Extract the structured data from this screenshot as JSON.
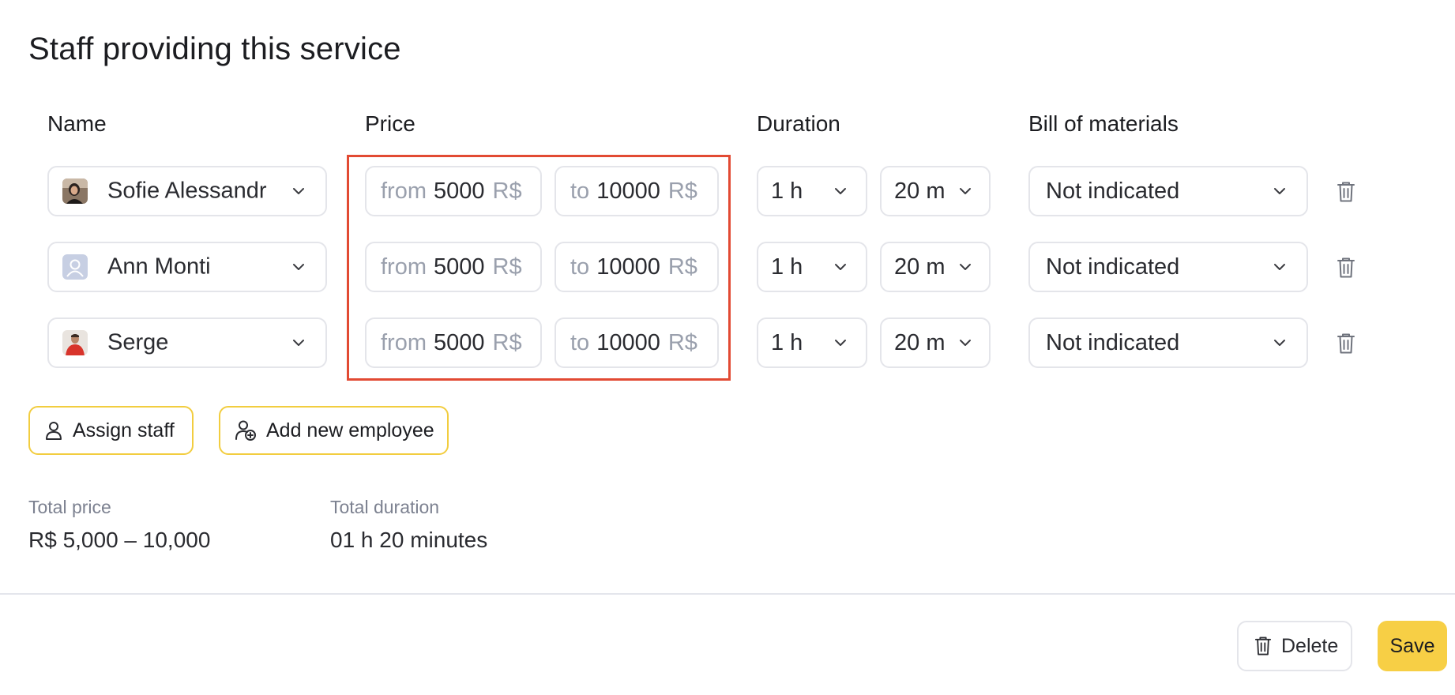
{
  "title": "Staff providing this service",
  "columns": {
    "name": "Name",
    "price": "Price",
    "duration": "Duration",
    "bom": "Bill of materials"
  },
  "rows": [
    {
      "name": "Sofie Alessandr",
      "avatar": "photo-avatar-woman",
      "from_label": "from",
      "from_value": "5000",
      "to_label": "to",
      "to_value": "10000",
      "currency": "R$",
      "hours": "1 h",
      "minutes": "20 m",
      "bom": "Not indicated"
    },
    {
      "name": "Ann Monti",
      "avatar": "placeholder-avatar",
      "from_label": "from",
      "from_value": "5000",
      "to_label": "to",
      "to_value": "10000",
      "currency": "R$",
      "hours": "1 h",
      "minutes": "20 m",
      "bom": "Not indicated"
    },
    {
      "name": "Serge",
      "avatar": "photo-avatar-man",
      "from_label": "from",
      "from_value": "5000",
      "to_label": "to",
      "to_value": "10000",
      "currency": "R$",
      "hours": "1 h",
      "minutes": "20 m",
      "bom": "Not indicated"
    }
  ],
  "actions": {
    "assign": "Assign staff",
    "add_new": "Add new employee"
  },
  "summary": {
    "total_price_label": "Total price",
    "total_price_value": "R$ 5,000 – 10,000",
    "total_duration_label": "Total duration",
    "total_duration_value": "01 h 20 minutes"
  },
  "footer": {
    "delete": "Delete",
    "save": "Save"
  },
  "colors": {
    "accent": "#f7cf45",
    "accent_border": "#f2cd3f",
    "highlight": "#e24a33",
    "muted": "#9aa0ad"
  },
  "icons": [
    "chevron-down-icon",
    "trash-icon",
    "user-icon",
    "user-add-icon"
  ]
}
